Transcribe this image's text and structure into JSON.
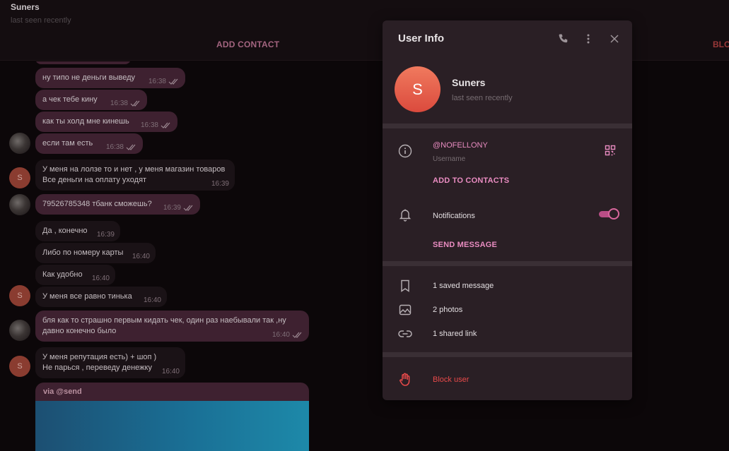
{
  "header": {
    "name": "Suners",
    "status": "last seen recently",
    "add_contact": "ADD CONTACT",
    "block_partial": "BLO"
  },
  "messages": [
    {
      "text": "ну типо не деньги выведу",
      "time": "16:38"
    },
    {
      "text": "а чек тебе кину",
      "time": "16:38"
    },
    {
      "text": "как ты холд мне кинешь",
      "time": "16:38"
    },
    {
      "text": "если там есть",
      "time": "16:38"
    },
    {
      "text": "У меня на лолзе то и нет , у меня магазин товаров\nВсе деньги на оплату уходят",
      "time": "16:39"
    },
    {
      "text": "79526785348 тбанк сможешь?",
      "time": "16:39"
    },
    {
      "text": "Да , конечно",
      "time": "16:39"
    },
    {
      "text": "Либо по номеру карты",
      "time": "16:40"
    },
    {
      "text": "Как удобно",
      "time": "16:40"
    },
    {
      "text": "У меня все равно тинька",
      "time": "16:40"
    },
    {
      "text": "бля как то страшно первым кидать чек, один раз наебывали так ,ну\nдавно конечно было",
      "time": "16:40"
    },
    {
      "text": "У меня репутация есть) + шоп )\nНе парься , переведу денежку",
      "time": "16:40"
    }
  ],
  "media": {
    "via": "via @send"
  },
  "avatar_letter": "S",
  "panel": {
    "title": "User Info",
    "name": "Suners",
    "status": "last seen recently",
    "avatar_letter": "S",
    "username": "@NOFELLONY",
    "username_label": "Username",
    "add_to_contacts": "ADD TO CONTACTS",
    "notifications": "Notifications",
    "notifications_on": true,
    "send_message": "SEND MESSAGE",
    "saved": "1 saved message",
    "photos": "2 photos",
    "links": "1 shared link",
    "block": "Block user"
  },
  "colors": {
    "accent": "#e98cc1",
    "danger": "#e84a4a",
    "outgoing_bubble": "#3e2130",
    "panel_bg": "#2a1f25"
  },
  "icons": [
    "phone-icon",
    "more-vertical-icon",
    "close-icon",
    "info-icon",
    "qr-code-icon",
    "bell-icon",
    "bookmark-icon",
    "photo-icon",
    "link-icon",
    "hand-stop-icon",
    "double-check-icon"
  ]
}
